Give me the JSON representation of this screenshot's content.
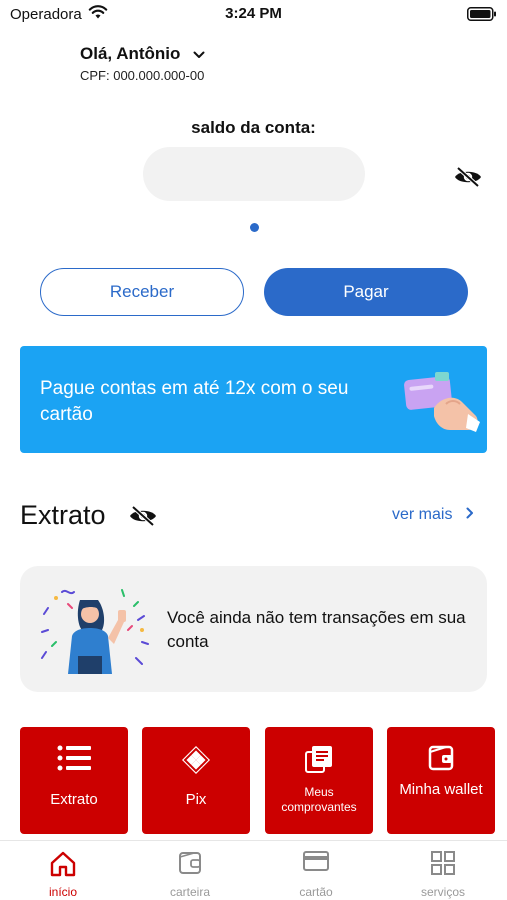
{
  "status_bar": {
    "carrier": "Operadora",
    "time": "3:24 PM"
  },
  "greeting": {
    "name": "Olá, Antônio",
    "cpf": "CPF: 000.000.000-00"
  },
  "balance": {
    "label": "saldo da conta:",
    "hidden": true
  },
  "actions": {
    "receive_label": "Receber",
    "pay_label": "Pagar"
  },
  "promo": {
    "text": "Pague contas em até 12x com o seu cartão",
    "color": "#1ba3f3"
  },
  "statement": {
    "title": "Extrato",
    "see_more": "ver mais",
    "empty_message": "Você ainda não tem transações em sua conta"
  },
  "shortcuts": [
    {
      "label": "Extrato",
      "icon": "list-icon"
    },
    {
      "label": "Pix",
      "icon": "pix-icon"
    },
    {
      "label": "Meus comprovantes",
      "icon": "receipts-icon"
    },
    {
      "label": "Minha wallet",
      "icon": "wallet-icon"
    }
  ],
  "tabbar": [
    {
      "label": "início",
      "icon": "home-icon",
      "active": true
    },
    {
      "label": "carteira",
      "icon": "wallet-icon",
      "active": false
    },
    {
      "label": "cartão",
      "icon": "card-icon",
      "active": false
    },
    {
      "label": "serviços",
      "icon": "grid-icon",
      "active": false
    }
  ],
  "colors": {
    "primary_blue": "#2b6ac9",
    "brand_red": "#cc0000",
    "promo_blue": "#1ba3f3"
  }
}
